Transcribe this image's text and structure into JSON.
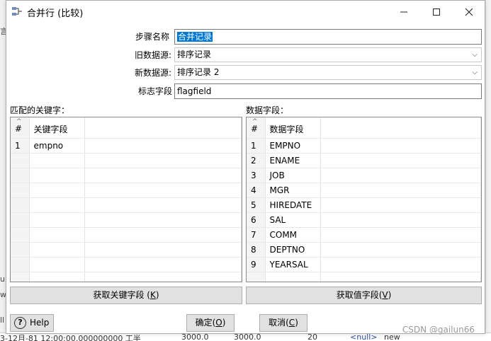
{
  "background": {
    "left_items": [
      "言",
      "u",
      "w",
      "ll"
    ],
    "bottom_row": [
      "3-12月-81 12:00:00.000000000 工半",
      "3000.0",
      "3000.0",
      "20",
      "<null>",
      "new"
    ]
  },
  "dialog": {
    "title": "合并行 (比较)",
    "step_name_label": "步骤名称",
    "step_name_value": "合并记录",
    "old_source_label": "旧数据源:",
    "old_source_value": "排序记录",
    "new_source_label": "新数据源:",
    "new_source_value": "排序记录 2",
    "flag_field_label": "标志字段",
    "flag_field_value": "flagfield"
  },
  "keys_panel": {
    "label": "匹配的关键字：",
    "headers": [
      "#",
      "关键字段"
    ],
    "rows": [
      [
        "1",
        "empno"
      ]
    ],
    "button_label": "获取关键字段 (",
    "button_mnemonic": "K",
    "button_suffix": ")"
  },
  "values_panel": {
    "label": "数据字段：",
    "headers": [
      "#",
      "数据字段"
    ],
    "rows": [
      [
        "1",
        "EMPNO"
      ],
      [
        "2",
        "ENAME"
      ],
      [
        "3",
        "JOB"
      ],
      [
        "4",
        "MGR"
      ],
      [
        "5",
        "HIREDATE"
      ],
      [
        "6",
        "SAL"
      ],
      [
        "7",
        "COMM"
      ],
      [
        "8",
        "DEPTNO"
      ],
      [
        "9",
        "YEARSAL"
      ]
    ],
    "button_label": "获取值字段(",
    "button_mnemonic": "V",
    "button_suffix": ")"
  },
  "footer": {
    "help_label": "Help",
    "ok_label": "确定(",
    "ok_mnemonic": "O",
    "ok_suffix": ")",
    "cancel_label": "取消(",
    "cancel_mnemonic": "C",
    "cancel_suffix": ")"
  },
  "watermark": "CSDN @gailun66"
}
